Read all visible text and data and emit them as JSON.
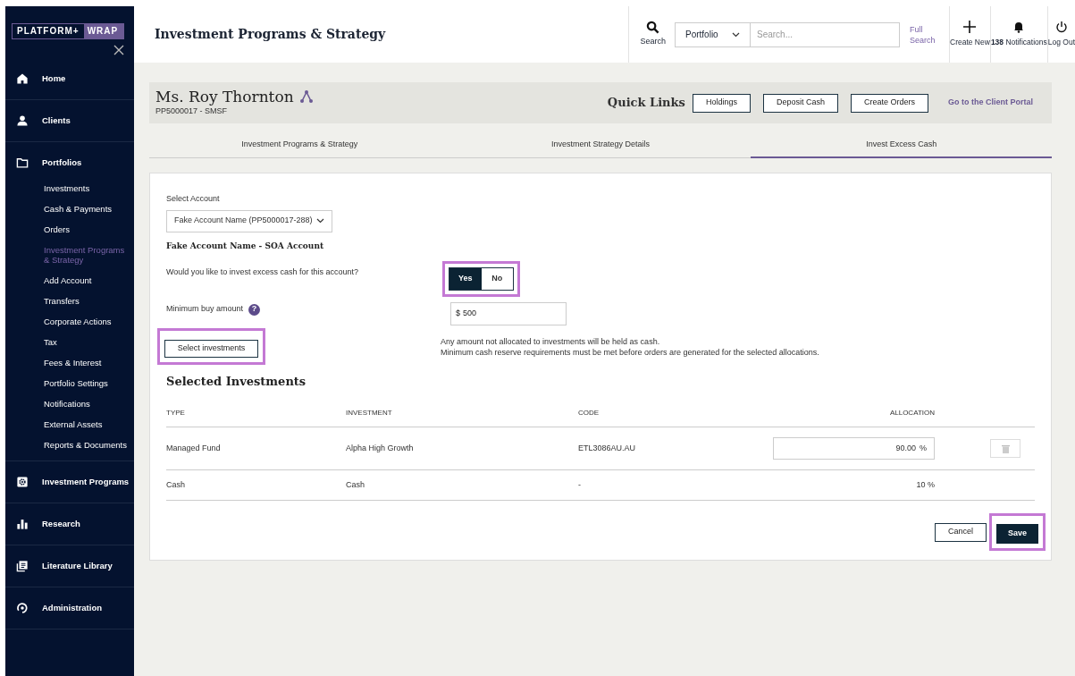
{
  "logo": {
    "left": "PLATFORM+",
    "right": "WRAP"
  },
  "sidebar": {
    "items": [
      {
        "label": "Home"
      },
      {
        "label": "Clients"
      },
      {
        "label": "Portfolios",
        "children": [
          {
            "label": "Investments",
            "selected": false
          },
          {
            "label": "Cash & Payments",
            "selected": false
          },
          {
            "label": "Orders",
            "selected": false
          },
          {
            "label": "Investment Programs & Strategy",
            "selected": true
          },
          {
            "label": "Add Account",
            "selected": false
          },
          {
            "label": "Transfers",
            "selected": false
          },
          {
            "label": "Corporate Actions",
            "selected": false
          },
          {
            "label": "Tax",
            "selected": false
          },
          {
            "label": "Fees & Interest",
            "selected": false
          },
          {
            "label": "Portfolio Settings",
            "selected": false
          },
          {
            "label": "Notifications",
            "selected": false
          },
          {
            "label": "External Assets",
            "selected": false
          },
          {
            "label": "Reports & Documents",
            "selected": false
          }
        ]
      },
      {
        "label": "Investment Programs"
      },
      {
        "label": "Research"
      },
      {
        "label": "Literature Library"
      },
      {
        "label": "Administration"
      }
    ]
  },
  "header": {
    "title": "Investment Programs & Strategy",
    "search_label": "Search",
    "search_scope": "Portfolio",
    "search_placeholder": "Search...",
    "full_search": "Full Search",
    "create_new": "Create New",
    "notifications_count": "138",
    "notifications_label": "Notifications",
    "log_out": "Log Out"
  },
  "client": {
    "name": "Ms. Roy Thornton",
    "id": "PP5000017 - SMSF",
    "quick_links_title": "Quick Links",
    "quick_links": [
      "Holdings",
      "Deposit Cash",
      "Create Orders"
    ],
    "portal_link": "Go to the Client Portal"
  },
  "tabs": [
    {
      "label": "Investment Programs & Strategy",
      "selected": false
    },
    {
      "label": "Investment Strategy Details",
      "selected": false
    },
    {
      "label": "Invest Excess Cash",
      "selected": true
    }
  ],
  "form": {
    "account_label": "Select Account",
    "account_value": "Fake Account Name (PP5000017-288)",
    "account_heading": "Fake Account Name - SOA Account",
    "invest_question": "Would you like to invest excess cash for this account?",
    "toggle": [
      {
        "label": "Yes",
        "selected": true
      },
      {
        "label": "No",
        "selected": false
      }
    ],
    "toggle_highlighted": true,
    "min_buy_label": "Minimum buy amount",
    "help": "?",
    "currency": "$",
    "min_buy_value": "500",
    "select_button": "Select investments",
    "select_highlighted": true,
    "note": [
      "Any amount not allocated to investments will be held as cash.",
      "Minimum cash reserve requirements must be met before orders are generated for the selected allocations."
    ]
  },
  "table": {
    "title": "Selected Investments",
    "columns": [
      "TYPE",
      "INVESTMENT",
      "CODE",
      "ALLOCATION"
    ],
    "rows": [
      {
        "kind": "editable",
        "type": "Managed Fund",
        "investment": "Alpha High Growth",
        "code": "ETL3086AU.AU",
        "allocation": "90.00",
        "unit": "%"
      },
      {
        "kind": "fixed",
        "type": "Cash",
        "investment": "Cash",
        "code": "-",
        "allocation": "10 %"
      }
    ]
  },
  "actions": {
    "cancel": "Cancel",
    "save": "Save",
    "save_highlighted": true
  }
}
